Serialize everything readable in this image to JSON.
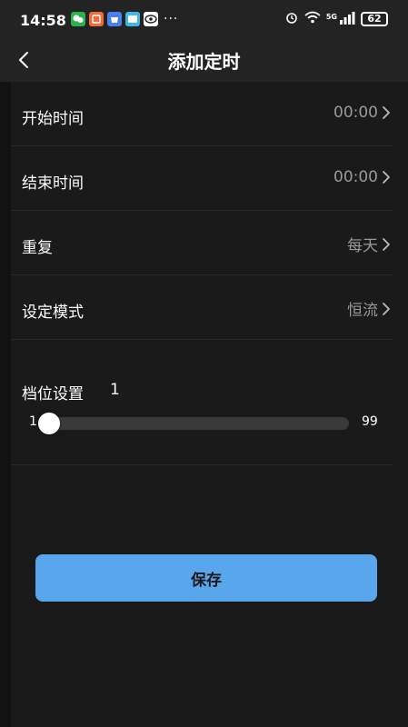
{
  "status_bar": {
    "time": "14:58",
    "battery": "62",
    "network": "5G",
    "more": "···"
  },
  "header": {
    "title": "添加定时"
  },
  "settings": [
    {
      "label": "开始时间",
      "value": "00:00"
    },
    {
      "label": "结束时间",
      "value": "00:00"
    },
    {
      "label": "重复",
      "value": "每天"
    },
    {
      "label": "设定模式",
      "value": "恒流"
    }
  ],
  "gear": {
    "label": "档位设置",
    "value": "1",
    "min": "1",
    "max": "99",
    "level_fraction": 0
  },
  "save": {
    "label": "保存"
  },
  "colors": {
    "accent": "#5aa6ec",
    "background": "#1a1a1a",
    "header": "#232323",
    "muted_text": "#9a9a9a"
  }
}
